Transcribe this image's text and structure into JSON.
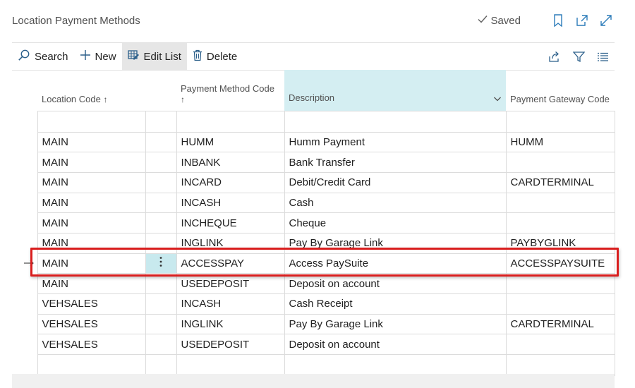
{
  "page": {
    "title": "Location Payment Methods",
    "saved_label": "Saved"
  },
  "toolbar": {
    "search_label": "Search",
    "new_label": "New",
    "edit_list_label": "Edit List",
    "delete_label": "Delete"
  },
  "columns": {
    "location_code": "Location Code",
    "payment_method_code": "Payment Method Code",
    "description": "Description",
    "payment_gateway_code": "Payment Gateway Code",
    "sort_indicator": "↑"
  },
  "rows": [
    {
      "location": "MAIN",
      "method": "HUMM",
      "description": "Humm Payment",
      "gateway": "HUMM"
    },
    {
      "location": "MAIN",
      "method": "INBANK",
      "description": "Bank Transfer",
      "gateway": ""
    },
    {
      "location": "MAIN",
      "method": "INCARD",
      "description": "Debit/Credit Card",
      "gateway": "CARDTERMINAL"
    },
    {
      "location": "MAIN",
      "method": "INCASH",
      "description": "Cash",
      "gateway": ""
    },
    {
      "location": "MAIN",
      "method": "INCHEQUE",
      "description": "Cheque",
      "gateway": ""
    },
    {
      "location": "MAIN",
      "method": "INGLINK",
      "description": "Pay By Garage Link",
      "gateway": "PAYBYGLINK"
    },
    {
      "location": "MAIN",
      "method": "ACCESSPAY",
      "description": "Access PaySuite",
      "gateway": "ACCESSPAYSUITE"
    },
    {
      "location": "MAIN",
      "method": "USEDEPOSIT",
      "description": "Deposit on account",
      "gateway": ""
    },
    {
      "location": "VEHSALES",
      "method": "INCASH",
      "description": "Cash Receipt",
      "gateway": ""
    },
    {
      "location": "VEHSALES",
      "method": "INGLINK",
      "description": "Pay By Garage Link",
      "gateway": "CARDTERMINAL"
    },
    {
      "location": "VEHSALES",
      "method": "USEDEPOSIT",
      "description": "Deposit on account",
      "gateway": ""
    }
  ],
  "selected_row_index": 6,
  "colors": {
    "highlight": "#d91e1e",
    "active_column": "#d4eef2",
    "row_action_cell": "#c8e9ee"
  },
  "icons": {
    "saved": "checkmark-icon",
    "bookmark": "bookmark-icon",
    "open_new": "open-in-new-window-icon",
    "expand": "expand-icon",
    "search": "search-icon",
    "new": "plus-icon",
    "edit_list": "edit-list-icon",
    "delete": "trash-icon",
    "share": "share-icon",
    "filter": "filter-icon",
    "list_view": "list-view-icon",
    "row_pointer": "arrow-right-icon",
    "row_actions": "more-vertical-icon"
  }
}
